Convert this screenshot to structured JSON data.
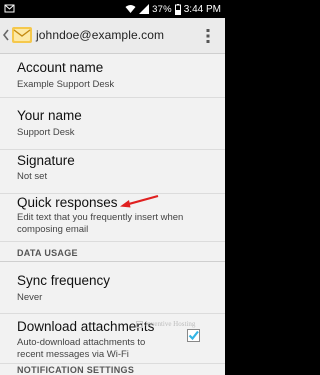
{
  "status_bar": {
    "battery_percent": "37%",
    "time": "3:44 PM"
  },
  "action_bar": {
    "account_email": "johndoe@example.com"
  },
  "preferences": {
    "account_name": {
      "title": "Account name",
      "summary": "Example Support Desk"
    },
    "your_name": {
      "title": "Your name",
      "summary": "Support Desk"
    },
    "signature": {
      "title": "Signature",
      "summary": "Not set"
    },
    "quick_responses": {
      "title": "Quick responses",
      "summary": "Edit text that you frequently insert when composing email"
    }
  },
  "data_usage": {
    "header": "DATA USAGE",
    "sync_frequency": {
      "title": "Sync frequency",
      "summary": "Never"
    },
    "download_attachments": {
      "title": "Download attachments",
      "summary": "Auto-download attachments to recent messages via Wi-Fi",
      "checked": true
    }
  },
  "notification_settings": {
    "header": "NOTIFICATION SETTINGS"
  },
  "watermark": "Inventive Hosting",
  "colors": {
    "accent": "#33b5e5",
    "arrow": "#e02020"
  }
}
